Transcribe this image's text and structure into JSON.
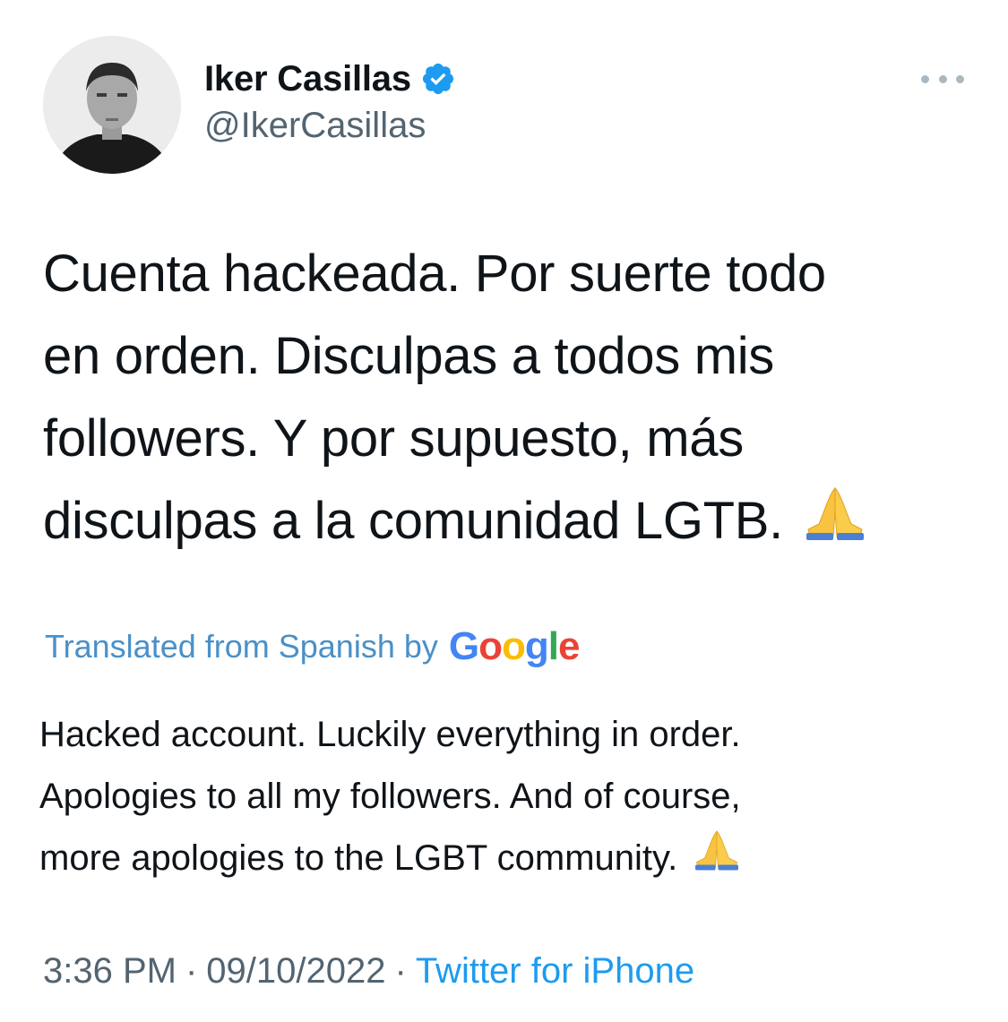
{
  "author": {
    "display_name": "Iker Casillas",
    "handle": "@IkerCasillas",
    "verified": true,
    "avatar_icon": "profile-photo"
  },
  "more_icon": "ellipsis-icon",
  "tweet": {
    "lines": [
      "Cuenta hackeada. Por suerte todo",
      "en orden. Disculpas a todos mis",
      "followers. Y por supuesto, más",
      "disculpas a la comunidad LGTB."
    ],
    "emoji": "🙏"
  },
  "translation": {
    "label": "Translated from Spanish by",
    "provider": "Google",
    "lines": [
      "Hacked account. Luckily everything in order.",
      "Apologies to all my followers. And of course,",
      "more apologies to the LGBT community."
    ]
  },
  "meta": {
    "time": "3:36 PM",
    "separator": "·",
    "date": "09/10/2022",
    "source": "Twitter for iPhone"
  },
  "colors": {
    "verified": "#1d9bf0",
    "link": "#1d9bf0",
    "secondary_text": "#536471",
    "translated_label": "#4a90c8"
  }
}
